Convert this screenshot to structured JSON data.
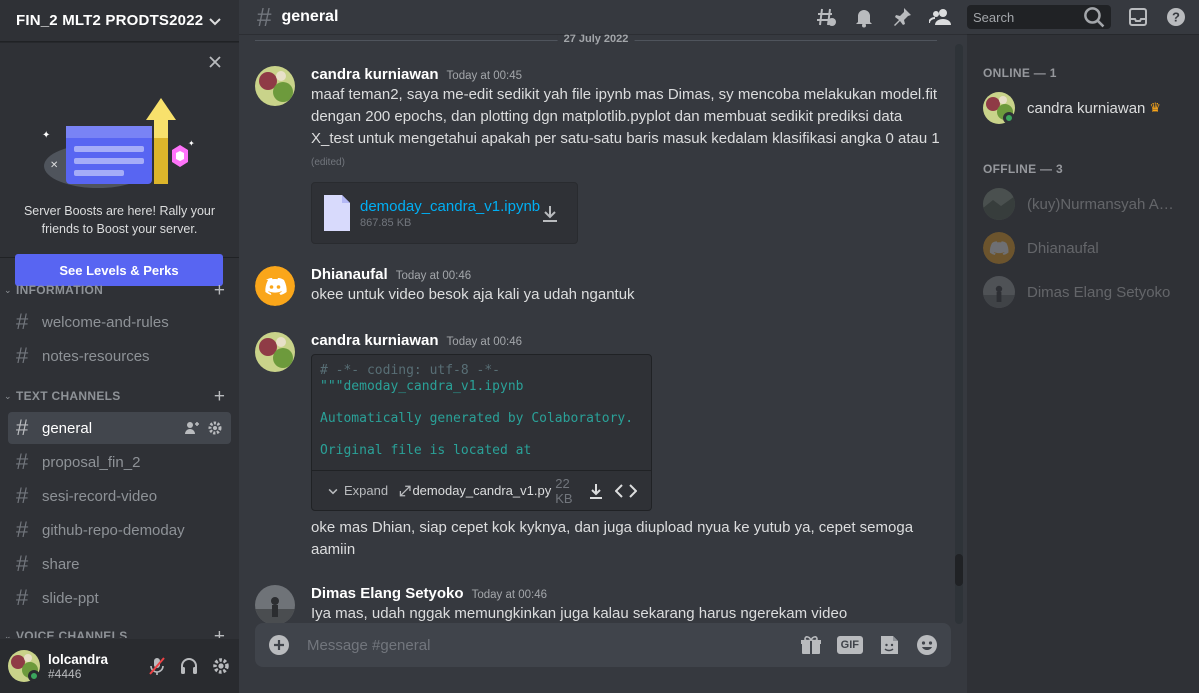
{
  "server": {
    "name": "FIN_2 MLT2 PRODTS2022"
  },
  "boost": {
    "text": "Server Boosts are here! Rally your friends to Boost your server.",
    "button": "See Levels & Perks"
  },
  "categories": {
    "information": "INFORMATION",
    "text_channels": "TEXT CHANNELS",
    "voice_channels": "VOICE CHANNELS"
  },
  "channels": {
    "info": [
      "welcome-and-rules",
      "notes-resources"
    ],
    "text": [
      "general",
      "proposal_fin_2",
      "sesi-record-video",
      "github-repo-demoday",
      "share",
      "slide-ppt"
    ]
  },
  "user": {
    "name": "lolcandra",
    "tag": "#4446"
  },
  "topbar": {
    "channel": "general",
    "search_placeholder": "Search"
  },
  "chat": {
    "date": "27 July 2022",
    "messages": [
      {
        "author": "candra kurniawan",
        "time": "Today at 00:45",
        "text": "maaf teman2, saya me-edit sedikit yah file ipynb mas Dimas, sy mencoba melakukan model.fit dengan 200 epochs, dan plotting dgn matplotlib.pyplot dan membuat sedikit prediksi data X_test untuk mengetahui apakah per satu-satu baris masuk kedalam klasifikasi angka 0 atau 1",
        "edited": "(edited)",
        "file": {
          "name": "demoday_candra_v1.ipynb",
          "size": "867.85 KB"
        }
      },
      {
        "author": "Dhianaufal",
        "time": "Today at 00:46",
        "text": "okee untuk video besok aja kali ya udah ngantuk"
      },
      {
        "author": "candra kurniawan",
        "time": "Today at 00:46",
        "code": {
          "line1": "# -*- coding: utf-8 -*-",
          "line2": "\"\"\"demoday_candra_v1.ipynb",
          "line3": "Automatically generated by Colaboratory.",
          "line4": "Original file is located at",
          "expand": "Expand",
          "filename": "demoday_candra_v1.py",
          "size": "22 KB"
        },
        "text": "oke mas Dhian, siap cepet kok kyknya, dan juga diupload nyua ke yutub ya, cepet semoga aamiin"
      },
      {
        "author": "Dimas Elang Setyoko",
        "time": "Today at 00:46",
        "text": "Iya mas, udah nggak memungkinkan juga kalau sekarang harus ngerekam video"
      }
    ]
  },
  "composer": {
    "placeholder": "Message #general",
    "gif": "GIF"
  },
  "members": {
    "online_label": "ONLINE — 1",
    "offline_label": "OFFLINE — 3",
    "online": [
      "candra kurniawan"
    ],
    "offline": [
      "(kuy)Nurmansyah Am...",
      "Dhianaufal",
      "Dimas Elang Setyoko"
    ]
  },
  "colors": {
    "accent": "#5865f2",
    "online": "#3ba55d",
    "link": "#00aff4",
    "crown": "#faa61a",
    "discord_orange": "#faa61a"
  }
}
